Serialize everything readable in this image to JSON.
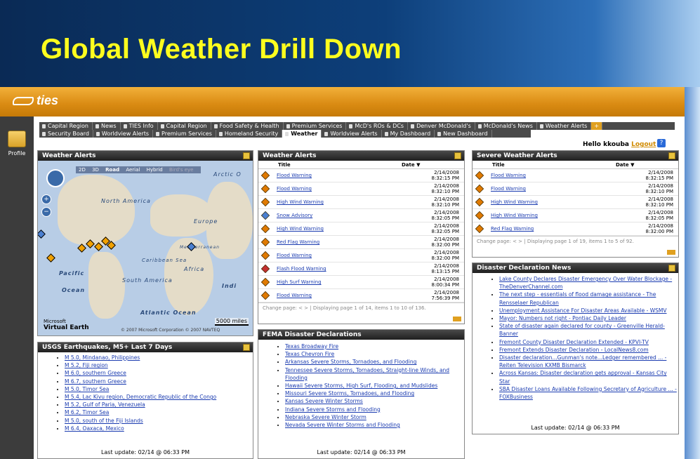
{
  "slide": {
    "title": "Global Weather Drill Down"
  },
  "app": {
    "logo": "ties",
    "profile_label": "Profile",
    "greeting": "Hello kkouba",
    "logout": "Logout",
    "help": "?",
    "tabs_row1": [
      "Capital Region",
      "News",
      "TIES Info",
      "Capital Region",
      "Food Safety & Health",
      "Premium Services",
      "McD's ROs & DCs",
      "Denver McDonald's",
      "McDonald's News",
      "Weather Alerts"
    ],
    "tabs_row2": [
      "Security Board",
      "Worldview Alerts",
      "Premium Services",
      "Homeland Security",
      "Weather",
      "Worldview Alerts",
      "My Dashboard",
      "New Dashboard"
    ],
    "active_tab": "Weather"
  },
  "map_panel": {
    "title": "Weather Alerts",
    "toolbar": [
      "2D",
      "3D",
      "Road",
      "Aerial",
      "Hybrid",
      "Bird's eye"
    ],
    "labels": [
      "Arctic O",
      "North America",
      "Europe",
      "Mediterranean",
      "Caribbean Sea",
      "Pacific",
      "Ocean",
      "South America",
      "Africa",
      "Atlantic Ocean",
      "Indi"
    ],
    "scale": "5000 miles",
    "brand_small": "Microsoft",
    "brand": "Virtual Earth",
    "copyright": "© 2007 Microsoft Corporation   © 2007 NAVTEQ"
  },
  "quakes": {
    "title": "USGS Earthquakes, M5+ Last 7 Days",
    "items": [
      "M 5.0, Mindanao, Philippines",
      "M 5.2, Fiji region",
      "M 6.0, southern Greece",
      "M 6.7, southern Greece",
      "M 5.0, Timor Sea",
      "M 5.4, Lac Kivu region, Democratic Republic of the Congo",
      "M 5.2, Gulf of Paria, Venezuela",
      "M 6.2, Timor Sea",
      "M 5.0, south of the Fiji Islands",
      "M 6.4, Oaxaca, Mexico"
    ],
    "last_update": "Last update: 02/14 @ 06:33 PM"
  },
  "alerts": {
    "title": "Weather Alerts",
    "col_title": "Title",
    "col_date": "Date ▼",
    "rows": [
      {
        "t": "Flood Warning",
        "d": "2/14/2008",
        "tm": "8:32:15 PM",
        "c": "orange"
      },
      {
        "t": "Flood Warning",
        "d": "2/14/2008",
        "tm": "8:32:10 PM",
        "c": "orange"
      },
      {
        "t": "High Wind Warning",
        "d": "2/14/2008",
        "tm": "8:32:10 PM",
        "c": "orange"
      },
      {
        "t": "Snow Advisory",
        "d": "2/14/2008",
        "tm": "8:32:05 PM",
        "c": "blue"
      },
      {
        "t": "High Wind Warning",
        "d": "2/14/2008",
        "tm": "8:32:05 PM",
        "c": "orange"
      },
      {
        "t": "Red Flag Warning",
        "d": "2/14/2008",
        "tm": "8:32:00 PM",
        "c": "orange"
      },
      {
        "t": "Flood Warning",
        "d": "2/14/2008",
        "tm": "8:32:00 PM",
        "c": "orange"
      },
      {
        "t": "Flash Flood Warning",
        "d": "2/14/2008",
        "tm": "8:13:15 PM",
        "c": "red"
      },
      {
        "t": "High Surf Warning",
        "d": "2/14/2008",
        "tm": "8:00:34 PM",
        "c": "orange"
      },
      {
        "t": "Flood Warning",
        "d": "2/14/2008",
        "tm": "7:56:39 PM",
        "c": "orange"
      }
    ],
    "pager": "Change page: < >  |  Displaying page 1 of 14, items 1 to 10 of 136."
  },
  "fema": {
    "title": "FEMA Disaster Declarations",
    "items": [
      "Texas Broadway Fire",
      "Texas Chevron Fire",
      "Arkansas Severe Storms, Tornadoes, and Flooding",
      "Tennessee Severe Storms, Tornadoes, Straight-line Winds, and Flooding",
      "Hawaii Severe Storms, High Surf, Flooding, and Mudslides",
      "Missouri Severe Storms, Tornadoes, and Flooding",
      "Kansas Severe Winter Storms",
      "Indiana Severe Storms and Flooding",
      "Nebraska Severe Winter Storm",
      "Nevada Severe Winter Storms and Flooding"
    ],
    "last_update": "Last update: 02/14 @ 06:33 PM"
  },
  "severe": {
    "title": "Severe Weather Alerts",
    "col_title": "Title",
    "col_date": "Date ▼",
    "rows": [
      {
        "t": "Flood Warning",
        "d": "2/14/2008",
        "tm": "8:32:15 PM",
        "c": "orange"
      },
      {
        "t": "Flood Warning",
        "d": "2/14/2008",
        "tm": "8:32:10 PM",
        "c": "orange"
      },
      {
        "t": "High Wind Warning",
        "d": "2/14/2008",
        "tm": "8:32:10 PM",
        "c": "orange"
      },
      {
        "t": "High Wind Warning",
        "d": "2/14/2008",
        "tm": "8:32:05 PM",
        "c": "orange"
      },
      {
        "t": "Red Flag Warning",
        "d": "2/14/2008",
        "tm": "8:32:00 PM",
        "c": "orange"
      }
    ],
    "pager": "Change page: < >  |  Displaying page 1 of 19, items 1 to 5 of 92."
  },
  "news": {
    "title": "Disaster Declaration News",
    "items": [
      "Lake County Declares Disaster Emergency Over Water Blockage - TheDenverChannel.com",
      "The next step - essentials of flood damage assistance - The Rensselaer Republican",
      "Unemployment Assistance For Disaster Areas Available - WSMV",
      "Mayor: Numbers not right - Pontiac Daily Leader",
      "State of disaster again declared for county - Greenville Herald-Banner",
      "Fremont County Disaster Declaration Extended - KPVI-TV",
      "Fremont Extends Disaster Declaration - LocalNews8.com",
      "Disaster declaration...Gunman's note...Ledger remembered ... - Reiten Television KXMB Bismarck",
      "Across Kansas: Disaster declaration gets approval - Kansas City Star",
      "SBA Disaster Loans Available Following Secretary of Agriculture ... - FOXBusiness"
    ],
    "last_update": "Last update: 02/14 @ 06:33 PM"
  }
}
